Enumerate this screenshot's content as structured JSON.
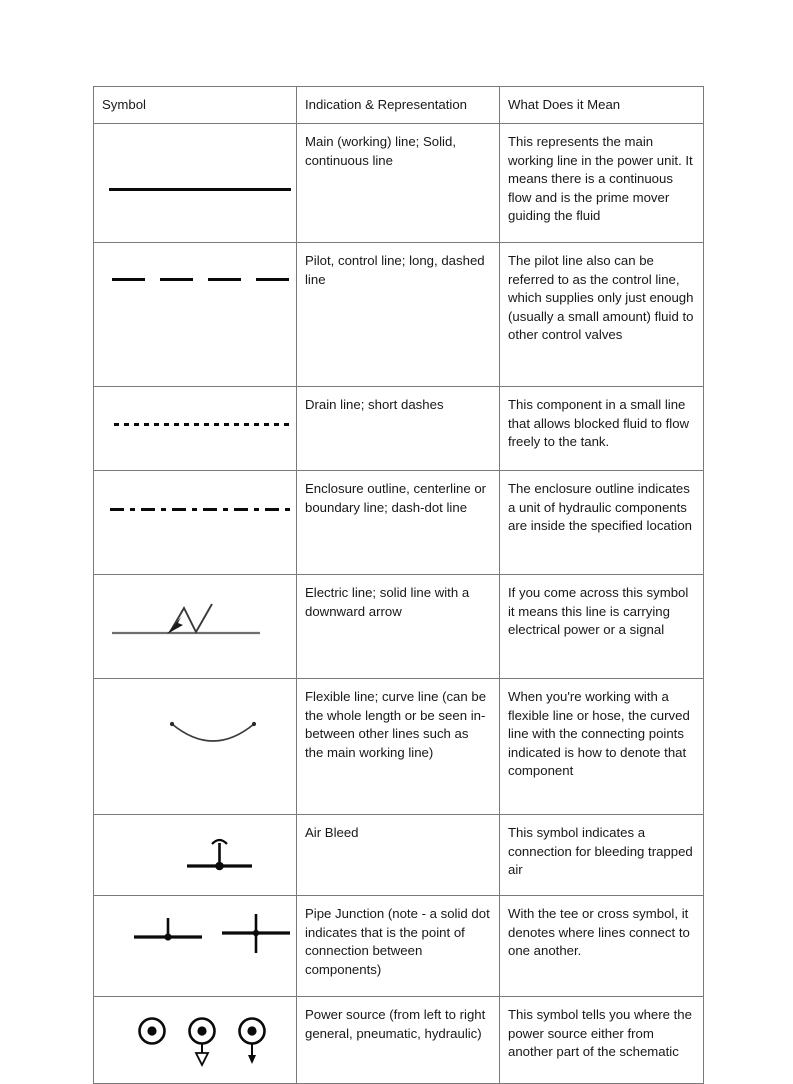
{
  "document": {
    "type": "hydraulic-symbol-reference-table"
  },
  "table": {
    "headers": [
      "Symbol",
      "Indication & Representation",
      "What Does it Mean"
    ],
    "rows": [
      {
        "symbol_name": "main-working-line-solid",
        "indication": "Main (working) line; Solid, continuous line",
        "meaning": "This represents the main working line in the power unit. It means there is a continuous flow and is the prime mover guiding the fluid"
      },
      {
        "symbol_name": "pilot-control-line-long-dashed",
        "indication": "Pilot, control line; long, dashed line",
        "meaning": "The pilot line also can be referred to as the control line, which supplies only just enough (usually a small amount) fluid to other control valves"
      },
      {
        "symbol_name": "drain-line-short-dashes",
        "indication": "Drain line; short dashes",
        "meaning": "This component in a small line that allows blocked fluid to flow freely to the tank."
      },
      {
        "symbol_name": "enclosure-outline-dash-dot-line",
        "indication": "Enclosure outline, centerline or boundary line; dash-dot line",
        "meaning": "The enclosure outline indicates a unit of hydraulic components are inside the specified location"
      },
      {
        "symbol_name": "electric-line-with-downward-arrow",
        "indication": "Electric line; solid line with a downward arrow",
        "meaning": "If you come across this symbol it means this line is carrying electrical power or a signal"
      },
      {
        "symbol_name": "flexible-line-curve",
        "indication": "Flexible line; curve line (can be the whole length or be seen in-between other lines such as the main working line)",
        "meaning": "When you're working with a flexible line or hose, the curved line with the connecting points indicated is how to denote that component"
      },
      {
        "symbol_name": "air-bleed",
        "indication": "Air Bleed",
        "meaning": "This symbol indicates a connection for bleeding trapped air"
      },
      {
        "symbol_name": "pipe-junction-tee-and-cross",
        "indication": "Pipe Junction (note - a solid dot indicates that is the point of connection between components)",
        "meaning": "With the tee or cross symbol, it denotes where lines connect to one another."
      },
      {
        "symbol_name": "power-source-general-pneumatic-hydraulic",
        "indication": "Power source (from left to right general, pneumatic, hydraulic)",
        "meaning": "This symbol tells you where the power source either from another part of the schematic"
      }
    ]
  },
  "colors": {
    "page_background": "#ffffff",
    "border": "#7a7a7a",
    "text": "#181818",
    "symbol_black": "#0a0a0a",
    "symbol_gray": "#6e6e6e"
  }
}
